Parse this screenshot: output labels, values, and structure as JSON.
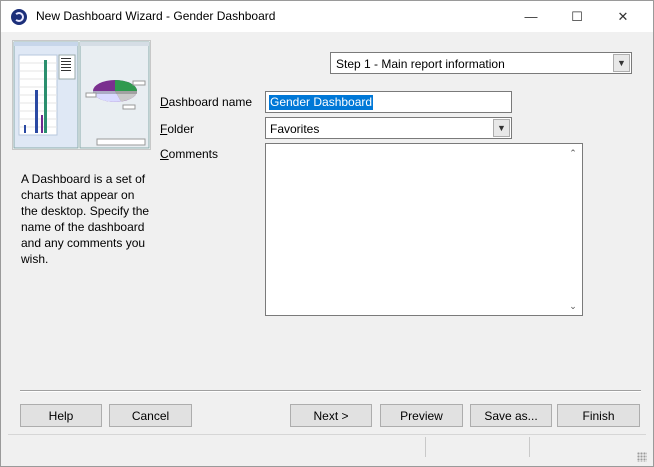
{
  "window": {
    "title": "New Dashboard Wizard - Gender Dashboard",
    "controls": {
      "minimize": "—",
      "maximize": "☐",
      "close": "✕"
    }
  },
  "description": "A Dashboard is a set of charts that appear on the desktop. Specify the name of the dashboard and any comments you wish.",
  "step_selector": {
    "value": "Step 1 - Main report information"
  },
  "form": {
    "name_label_first": "D",
    "name_label_rest": "ashboard name",
    "name_value": "Gender Dashboard",
    "folder_label_first": "F",
    "folder_label_rest": "older",
    "folder_value": "Favorites",
    "comments_label_first": "C",
    "comments_label_rest": "omments",
    "comments_value": ""
  },
  "buttons": {
    "help": "Help",
    "cancel": "Cancel",
    "next": "Next >",
    "preview": "Preview",
    "save_as": "Save as...",
    "finish": "Finish"
  },
  "colors": {
    "selection": "#0078d7",
    "window_bg": "#f0f0f0",
    "button_bg": "#e1e1e1"
  }
}
